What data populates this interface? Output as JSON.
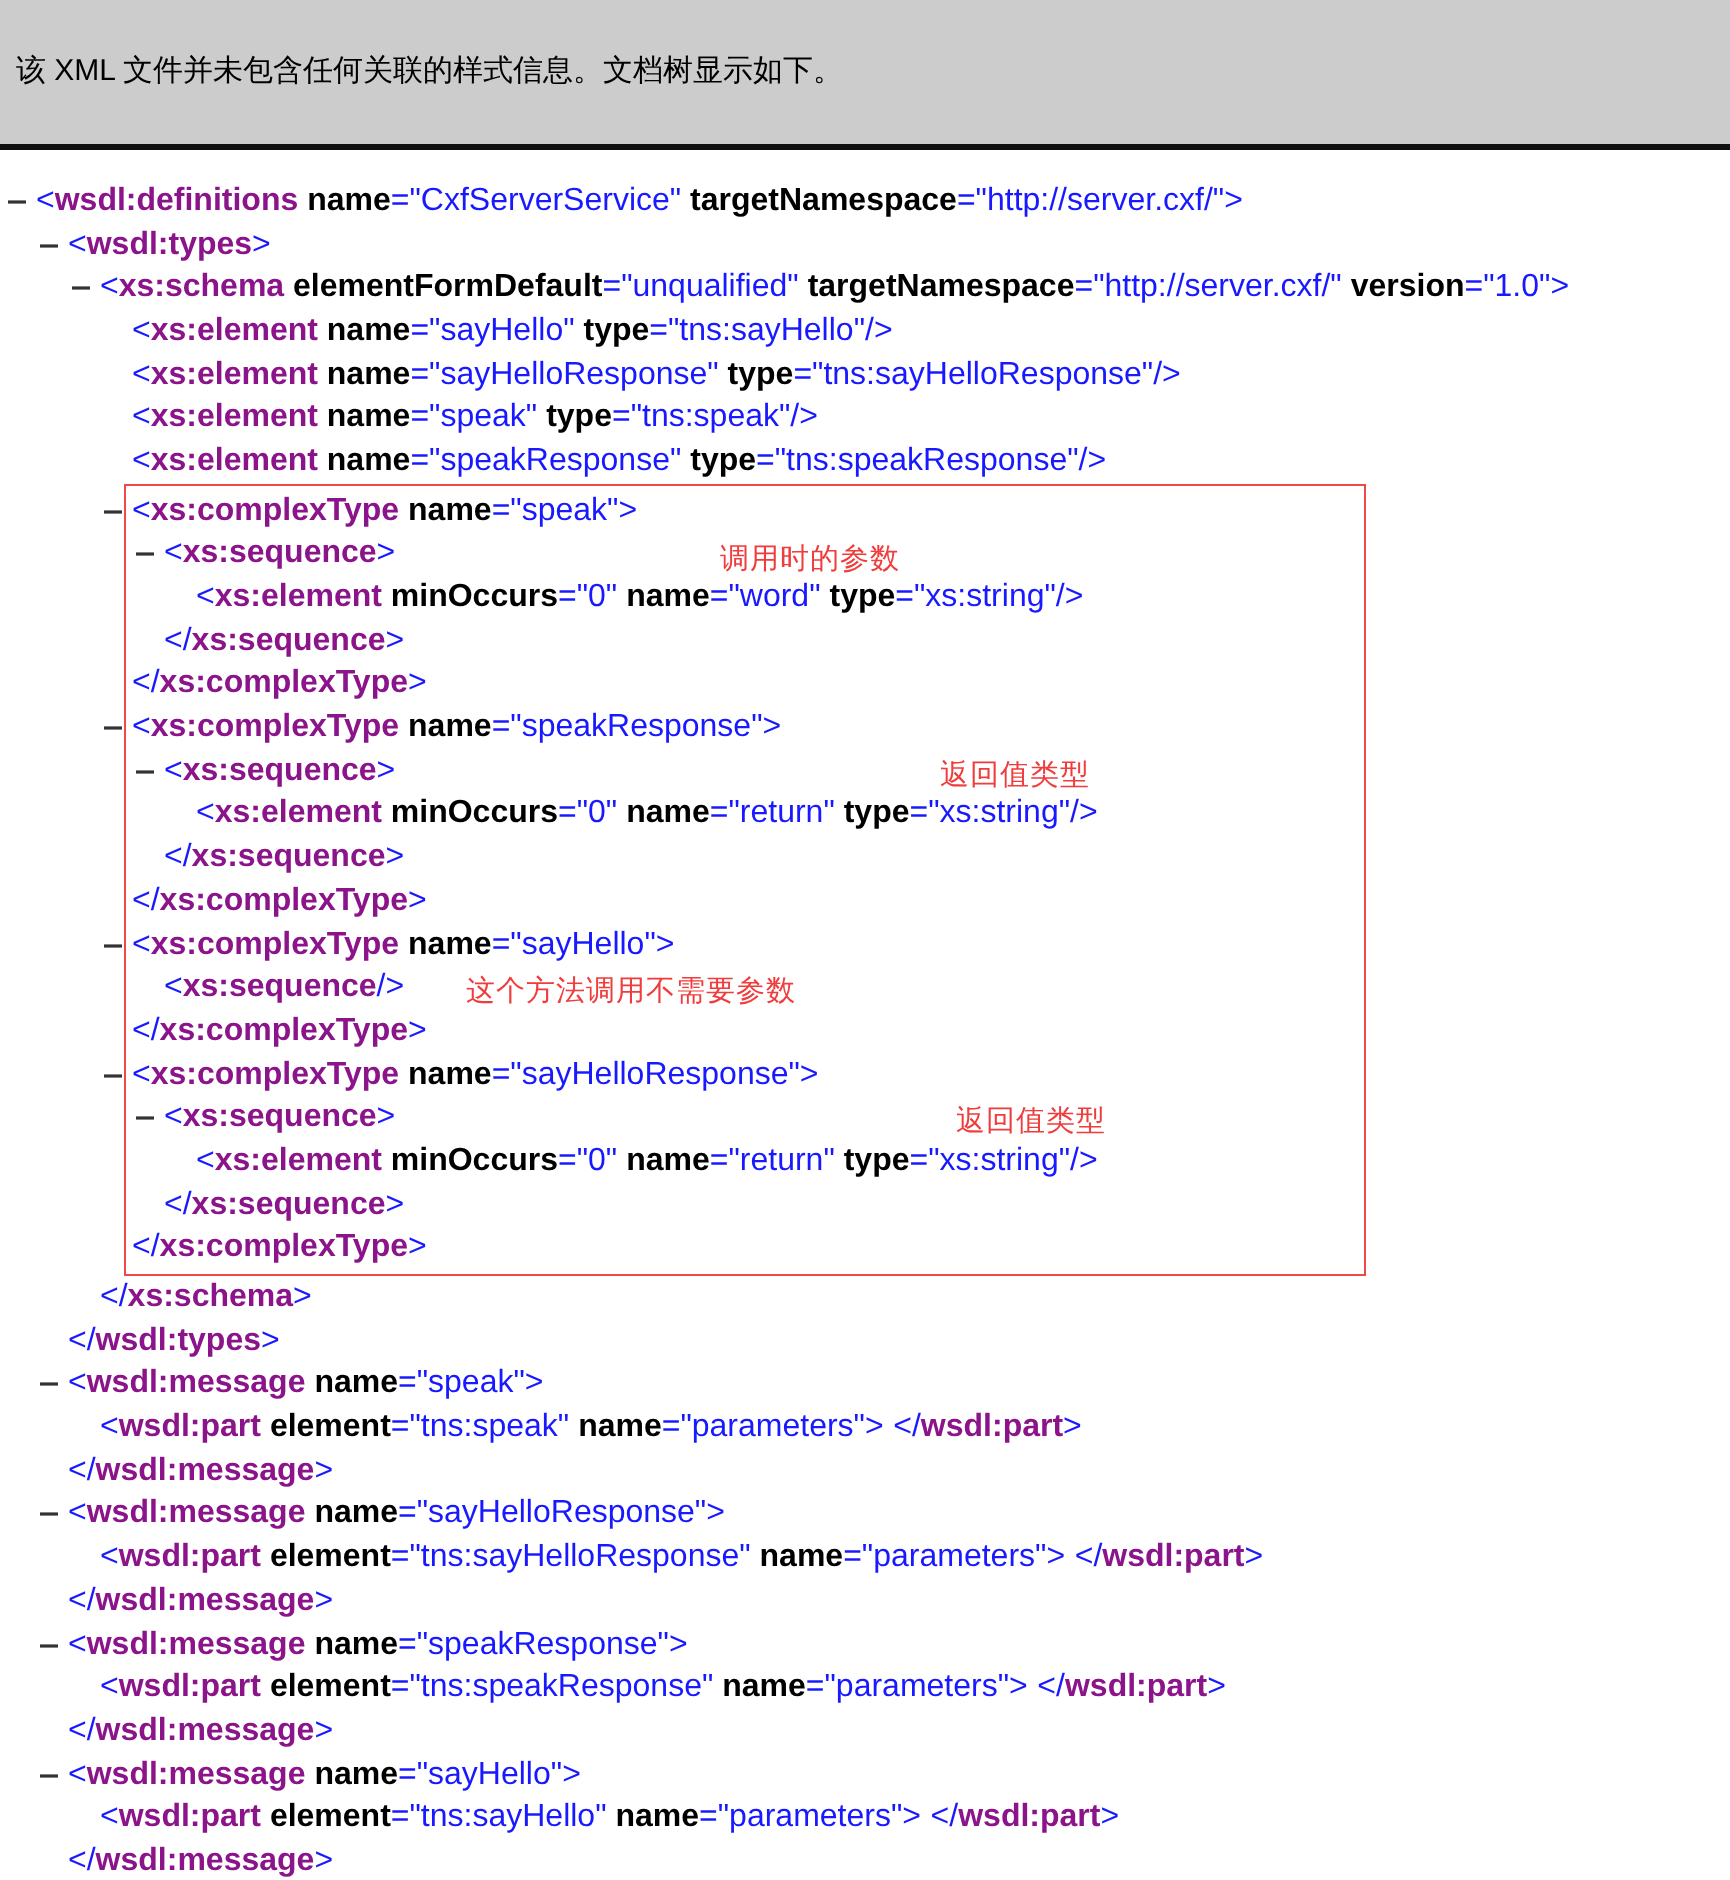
{
  "banner": {
    "text": "该 XML 文件并未包含任何关联的样式信息。文档树显示如下。"
  },
  "tree": [
    {
      "kind": "open",
      "expanded": true,
      "lt": "<",
      "tag": "wsdl:definitions",
      "attrs": [
        {
          "name": "name",
          "value": "=\"CxfServerService\""
        },
        {
          "name": "targetNamespace",
          "value": "=\"http://server.cxf/\""
        }
      ],
      "gt": ">",
      "children": [
        {
          "kind": "open",
          "expanded": true,
          "lt": "<",
          "tag": "wsdl:types",
          "gt": ">",
          "children": [
            {
              "kind": "open",
              "expanded": true,
              "lt": "<",
              "tag": "xs:schema",
              "attrs": [
                {
                  "name": "elementFormDefault",
                  "value": "=\"unqualified\""
                },
                {
                  "name": "targetNamespace",
                  "value": "=\"http://server.cxf/\""
                },
                {
                  "name": "version",
                  "value": "=\"1.0\""
                }
              ],
              "gt": ">",
              "children": [
                {
                  "kind": "leaf",
                  "lt": "<",
                  "tag": "xs:element",
                  "attrs": [
                    {
                      "name": "name",
                      "value": "=\"sayHello\""
                    },
                    {
                      "name": "type",
                      "value": "=\"tns:sayHello\""
                    }
                  ],
                  "gt": "/>"
                },
                {
                  "kind": "leaf",
                  "lt": "<",
                  "tag": "xs:element",
                  "attrs": [
                    {
                      "name": "name",
                      "value": "=\"sayHelloResponse\""
                    },
                    {
                      "name": "type",
                      "value": "=\"tns:sayHelloResponse\""
                    }
                  ],
                  "gt": "/>"
                },
                {
                  "kind": "leaf",
                  "lt": "<",
                  "tag": "xs:element",
                  "attrs": [
                    {
                      "name": "name",
                      "value": "=\"speak\""
                    },
                    {
                      "name": "type",
                      "value": "=\"tns:speak\""
                    }
                  ],
                  "gt": "/>"
                },
                {
                  "kind": "leaf",
                  "lt": "<",
                  "tag": "xs:element",
                  "attrs": [
                    {
                      "name": "name",
                      "value": "=\"speakResponse\""
                    },
                    {
                      "name": "type",
                      "value": "=\"tns:speakResponse\""
                    }
                  ],
                  "gt": "/>"
                },
                {
                  "kind": "highlight-box",
                  "children": [
                    {
                      "kind": "open",
                      "expanded": true,
                      "lt": "<",
                      "tag": "xs:complexType",
                      "attrs": [
                        {
                          "name": "name",
                          "value": "=\"speak\""
                        }
                      ],
                      "gt": ">",
                      "children": [
                        {
                          "kind": "open",
                          "expanded": true,
                          "lt": "<",
                          "tag": "xs:sequence",
                          "gt": ">",
                          "note": "调用时的参数",
                          "children": [
                            {
                              "kind": "leaf",
                              "lt": "<",
                              "tag": "xs:element",
                              "attrs": [
                                {
                                  "name": "minOccurs",
                                  "value": "=\"0\""
                                },
                                {
                                  "name": "name",
                                  "value": "=\"word\""
                                },
                                {
                                  "name": "type",
                                  "value": "=\"xs:string\""
                                }
                              ],
                              "gt": "/>"
                            }
                          ],
                          "close_lt": "</",
                          "close_tag": "xs:sequence",
                          "close_gt": ">"
                        }
                      ],
                      "close_lt": "</",
                      "close_tag": "xs:complexType",
                      "close_gt": ">"
                    },
                    {
                      "kind": "open",
                      "expanded": true,
                      "lt": "<",
                      "tag": "xs:complexType",
                      "attrs": [
                        {
                          "name": "name",
                          "value": "=\"speakResponse\""
                        }
                      ],
                      "gt": ">",
                      "children": [
                        {
                          "kind": "open",
                          "expanded": true,
                          "lt": "<",
                          "tag": "xs:sequence",
                          "gt": ">",
                          "note": "返回值类型",
                          "children": [
                            {
                              "kind": "leaf",
                              "lt": "<",
                              "tag": "xs:element",
                              "attrs": [
                                {
                                  "name": "minOccurs",
                                  "value": "=\"0\""
                                },
                                {
                                  "name": "name",
                                  "value": "=\"return\""
                                },
                                {
                                  "name": "type",
                                  "value": "=\"xs:string\""
                                }
                              ],
                              "gt": "/>"
                            }
                          ],
                          "close_lt": "</",
                          "close_tag": "xs:sequence",
                          "close_gt": ">"
                        }
                      ],
                      "close_lt": "</",
                      "close_tag": "xs:complexType",
                      "close_gt": ">"
                    },
                    {
                      "kind": "open",
                      "expanded": true,
                      "lt": "<",
                      "tag": "xs:complexType",
                      "attrs": [
                        {
                          "name": "name",
                          "value": "=\"sayHello\""
                        }
                      ],
                      "gt": ">",
                      "children": [
                        {
                          "kind": "leaf",
                          "lt": "<",
                          "tag": "xs:sequence",
                          "gt": "/>",
                          "note": "这个方法调用不需要参数"
                        }
                      ],
                      "close_lt": "</",
                      "close_tag": "xs:complexType",
                      "close_gt": ">"
                    },
                    {
                      "kind": "open",
                      "expanded": true,
                      "lt": "<",
                      "tag": "xs:complexType",
                      "attrs": [
                        {
                          "name": "name",
                          "value": "=\"sayHelloResponse\""
                        }
                      ],
                      "gt": ">",
                      "children": [
                        {
                          "kind": "open",
                          "expanded": true,
                          "lt": "<",
                          "tag": "xs:sequence",
                          "gt": ">",
                          "note": "返回值类型",
                          "children": [
                            {
                              "kind": "leaf",
                              "lt": "<",
                              "tag": "xs:element",
                              "attrs": [
                                {
                                  "name": "minOccurs",
                                  "value": "=\"0\""
                                },
                                {
                                  "name": "name",
                                  "value": "=\"return\""
                                },
                                {
                                  "name": "type",
                                  "value": "=\"xs:string\""
                                }
                              ],
                              "gt": "/>"
                            }
                          ],
                          "close_lt": "</",
                          "close_tag": "xs:sequence",
                          "close_gt": ">"
                        }
                      ],
                      "close_lt": "</",
                      "close_tag": "xs:complexType",
                      "close_gt": ">"
                    }
                  ]
                }
              ],
              "close_lt": "</",
              "close_tag": "xs:schema",
              "close_gt": ">"
            }
          ],
          "close_lt": "</",
          "close_tag": "wsdl:types",
          "close_gt": ">"
        },
        {
          "kind": "open",
          "expanded": true,
          "lt": "<",
          "tag": "wsdl:message",
          "attrs": [
            {
              "name": "name",
              "value": "=\"speak\""
            }
          ],
          "gt": ">",
          "children": [
            {
              "kind": "inline",
              "lt": "<",
              "tag": "wsdl:part",
              "attrs": [
                {
                  "name": "element",
                  "value": "=\"tns:speak\""
                },
                {
                  "name": "name",
                  "value": "=\"parameters\""
                }
              ],
              "gt": ">",
              "close_lt": "</",
              "close_tag": "wsdl:part",
              "close_gt": ">"
            }
          ],
          "close_lt": "</",
          "close_tag": "wsdl:message",
          "close_gt": ">"
        },
        {
          "kind": "open",
          "expanded": true,
          "lt": "<",
          "tag": "wsdl:message",
          "attrs": [
            {
              "name": "name",
              "value": "=\"sayHelloResponse\""
            }
          ],
          "gt": ">",
          "children": [
            {
              "kind": "inline",
              "lt": "<",
              "tag": "wsdl:part",
              "attrs": [
                {
                  "name": "element",
                  "value": "=\"tns:sayHelloResponse\""
                },
                {
                  "name": "name",
                  "value": "=\"parameters\""
                }
              ],
              "gt": ">",
              "close_lt": "</",
              "close_tag": "wsdl:part",
              "close_gt": ">"
            }
          ],
          "close_lt": "</",
          "close_tag": "wsdl:message",
          "close_gt": ">"
        },
        {
          "kind": "open",
          "expanded": true,
          "lt": "<",
          "tag": "wsdl:message",
          "attrs": [
            {
              "name": "name",
              "value": "=\"speakResponse\""
            }
          ],
          "gt": ">",
          "children": [
            {
              "kind": "inline",
              "lt": "<",
              "tag": "wsdl:part",
              "attrs": [
                {
                  "name": "element",
                  "value": "=\"tns:speakResponse\""
                },
                {
                  "name": "name",
                  "value": "=\"parameters\""
                }
              ],
              "gt": ">",
              "close_lt": "</",
              "close_tag": "wsdl:part",
              "close_gt": ">"
            }
          ],
          "close_lt": "</",
          "close_tag": "wsdl:message",
          "close_gt": ">"
        },
        {
          "kind": "open",
          "expanded": true,
          "lt": "<",
          "tag": "wsdl:message",
          "attrs": [
            {
              "name": "name",
              "value": "=\"sayHello\""
            }
          ],
          "gt": ">",
          "children": [
            {
              "kind": "inline",
              "lt": "<",
              "tag": "wsdl:part",
              "attrs": [
                {
                  "name": "element",
                  "value": "=\"tns:sayHello\""
                },
                {
                  "name": "name",
                  "value": "=\"parameters\""
                }
              ],
              "gt": ">",
              "close_lt": "</",
              "close_tag": "wsdl:part",
              "close_gt": ">"
            }
          ],
          "close_lt": "</",
          "close_tag": "wsdl:message",
          "close_gt": ">"
        }
      ]
    }
  ]
}
